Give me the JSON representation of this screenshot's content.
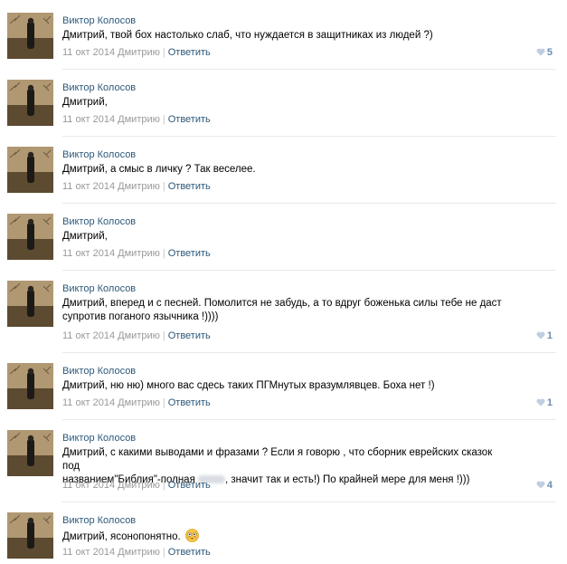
{
  "comments": [
    {
      "author": "Виктор Колосов",
      "text": "Дмитрий, твой бох настолько слаб, что нуждается в защитниках из людей ?)",
      "date": "11 окт 2014",
      "to": "Дмитрию",
      "reply": "Ответить",
      "likes": "5"
    },
    {
      "author": "Виктор Колосов",
      "text": "Дмитрий,",
      "date": "11 окт 2014",
      "to": "Дмитрию",
      "reply": "Ответить",
      "likes": ""
    },
    {
      "author": "Виктор Колосов",
      "text": "Дмитрий, а смыс в личку ? Так веселее.",
      "date": "11 окт 2014",
      "to": "Дмитрию",
      "reply": "Ответить",
      "likes": ""
    },
    {
      "author": "Виктор Колосов",
      "text": "Дмитрий,",
      "date": "11 окт 2014",
      "to": "Дмитрию",
      "reply": "Ответить",
      "likes": ""
    },
    {
      "author": "Виктор Колосов",
      "text_line1": "Дмитрий, вперед и с песней. Помолится не забудь, а то вдруг боженька силы тебе не даст",
      "text_line2": "супротив поганого язычника !))))",
      "date": "11 окт 2014",
      "to": "Дмитрию",
      "reply": "Ответить",
      "likes": "1"
    },
    {
      "author": "Виктор Колосов",
      "text": "Дмитрий, ню ню) много вас сдесь таких ПГМнутых вразумлявцев. Боха нет !)",
      "date": "11 окт 2014",
      "to": "Дмитрию",
      "reply": "Ответить",
      "likes": "1"
    },
    {
      "author": "Виктор Колосов",
      "text_line1": "Дмитрий, с какими выводами и фразами ? Если я говорю , что сборник еврейских сказок под",
      "text_line2a": "названием\"Библия\"-полная",
      "text_line2b": ", значит так и есть!) По крайней мере для меня !)))",
      "date": "11 окт 2014",
      "to": "Дмитрию",
      "reply": "Ответить",
      "likes": "4"
    },
    {
      "author": "Виктор Колосов",
      "text": "Дмитрий, ясонопонятно.",
      "date": "11 окт 2014",
      "to": "Дмитрию",
      "reply": "Ответить",
      "likes": ""
    }
  ],
  "colors": {
    "link": "#2b587a",
    "meta": "#999999",
    "likes": "#6b8db2",
    "divider": "#e7eaed"
  },
  "icons": {
    "like": "heart-icon",
    "emoji": "flushed-face-emoji"
  }
}
